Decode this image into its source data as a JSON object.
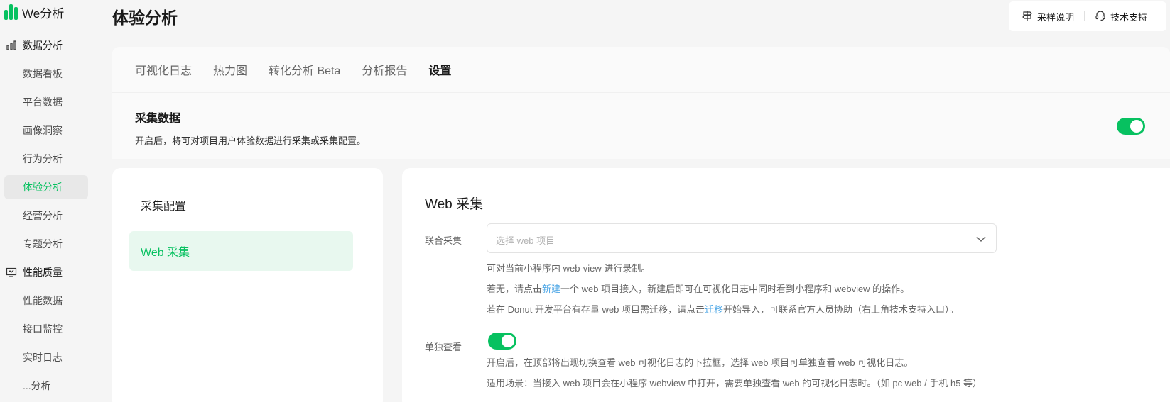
{
  "app": {
    "name": "We分析"
  },
  "sidebar": {
    "groups": [
      {
        "label": "数据分析",
        "icon": "bar-chart-icon"
      },
      {
        "label": "性能质量",
        "icon": "monitor-icon"
      }
    ],
    "items": [
      {
        "label": "数据看板"
      },
      {
        "label": "平台数据"
      },
      {
        "label": "画像洞察"
      },
      {
        "label": "行为分析"
      },
      {
        "label": "体验分析",
        "active": true
      },
      {
        "label": "经营分析"
      },
      {
        "label": "专题分析"
      },
      {
        "label": "性能数据"
      },
      {
        "label": "接口监控"
      },
      {
        "label": "实时日志"
      },
      {
        "label": "...分析"
      }
    ]
  },
  "header": {
    "title": "体验分析",
    "actions": [
      {
        "label": "采样说明",
        "icon": "signpost-icon"
      },
      {
        "label": "技术支持",
        "icon": "headset-icon"
      }
    ]
  },
  "tabs": [
    {
      "label": "可视化日志"
    },
    {
      "label": "热力图"
    },
    {
      "label": "转化分析 Beta"
    },
    {
      "label": "分析报告"
    },
    {
      "label": "设置",
      "active": true
    }
  ],
  "collect": {
    "title": "采集数据",
    "desc": "开启后，将可对项目用户体验数据进行采集或采集配置。",
    "enabled": true
  },
  "config": {
    "title": "采集配置",
    "items": [
      {
        "label": "Web 采集",
        "active": true
      }
    ]
  },
  "web": {
    "title": "Web 采集",
    "joint": {
      "label": "联合采集",
      "placeholder": "选择 web 项目",
      "help1": "可对当前小程序内 web-view 进行录制。",
      "help2_pre": "若无，请点击",
      "help2_link": "新建",
      "help2_post": "一个 web 项目接入，新建后即可在可视化日志中同时看到小程序和 webview 的操作。",
      "help3_pre": "若在 Donut 开发平台有存量 web 项目需迁移，请点击",
      "help3_link": "迁移",
      "help3_post": "开始导入，可联系官方人员协助（右上角技术支持入口）。"
    },
    "standalone": {
      "label": "单独查看",
      "enabled": true,
      "help1": "开启后，在顶部将出现切换查看 web 可视化日志的下拉框，选择 web 项目可单独查看 web 可视化日志。",
      "help2": "适用场景：当接入 web 项目会在小程序 webview 中打开，需要单独查看 web 的可视化日志时。（如 pc web / 手机 h5 等）"
    }
  },
  "colors": {
    "accent": "#07c160",
    "link": "#4ea7e6",
    "active_bg": "#e8f8ef"
  }
}
